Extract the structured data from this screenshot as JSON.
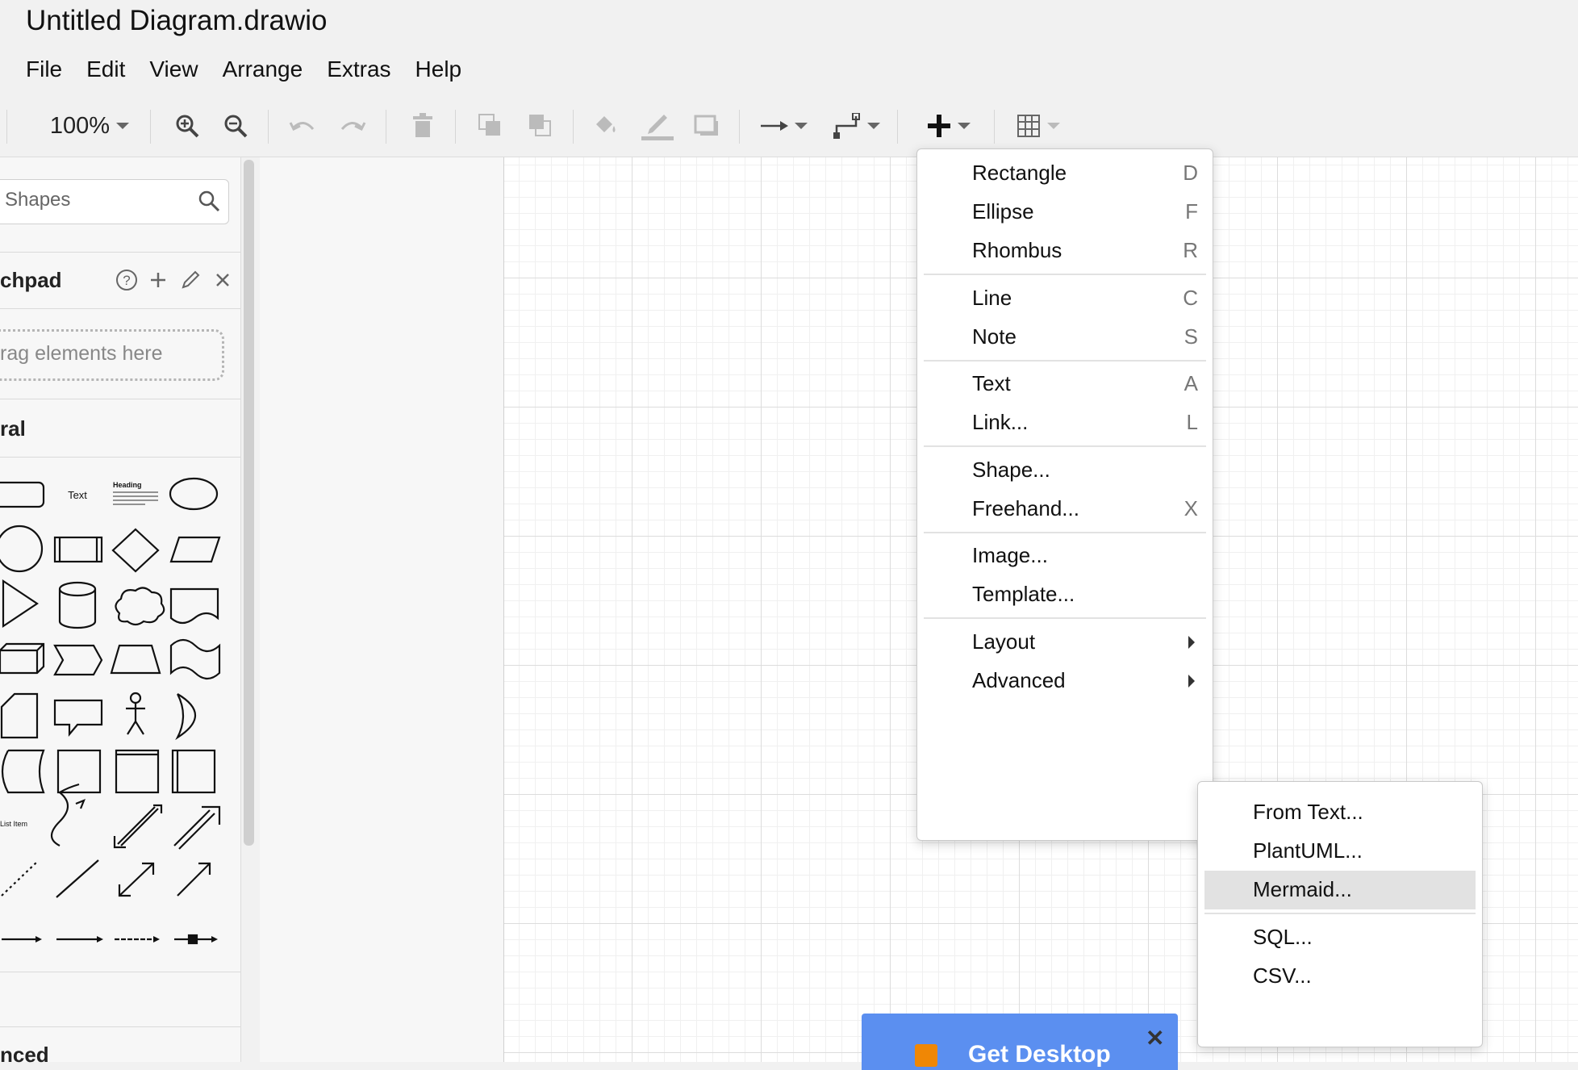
{
  "app": {
    "title": "Untitled Diagram.drawio"
  },
  "menubar": [
    "File",
    "Edit",
    "View",
    "Arrange",
    "Extras",
    "Help"
  ],
  "toolbar": {
    "zoom": "100%",
    "icons": [
      "zoom-in-icon",
      "zoom-out-icon",
      "undo-icon",
      "redo-icon",
      "delete-icon",
      "to-front-icon",
      "to-back-icon",
      "fill-color-icon",
      "line-color-icon",
      "shadow-icon",
      "connection-icon",
      "waypoints-icon",
      "insert-plus-icon",
      "table-icon"
    ]
  },
  "sidebar": {
    "search_placeholder": "Shapes",
    "scratchpad_title": "chpad",
    "drop_text": "rag elements here",
    "general_title": "ral",
    "advanced_title": "nced",
    "shape_labels": {
      "text": "Text",
      "heading": "Heading",
      "list_item": "List Item"
    }
  },
  "insert_menu": {
    "groups": [
      [
        {
          "label": "Rectangle",
          "key": "D"
        },
        {
          "label": "Ellipse",
          "key": "F"
        },
        {
          "label": "Rhombus",
          "key": "R"
        }
      ],
      [
        {
          "label": "Line",
          "key": "C"
        },
        {
          "label": "Note",
          "key": "S"
        }
      ],
      [
        {
          "label": "Text",
          "key": "A"
        },
        {
          "label": "Link...",
          "key": "L"
        }
      ],
      [
        {
          "label": "Shape...",
          "key": ""
        },
        {
          "label": "Freehand...",
          "key": "X"
        }
      ],
      [
        {
          "label": "Image...",
          "key": ""
        },
        {
          "label": "Template...",
          "key": ""
        }
      ],
      [
        {
          "label": "Layout",
          "key": "",
          "submenu": true
        },
        {
          "label": "Advanced",
          "key": "",
          "submenu": true
        }
      ]
    ]
  },
  "advanced_menu": {
    "groups": [
      [
        {
          "label": "From Text..."
        },
        {
          "label": "PlantUML..."
        },
        {
          "label": "Mermaid...",
          "highlighted": true
        }
      ],
      [
        {
          "label": "SQL..."
        },
        {
          "label": "CSV..."
        }
      ]
    ]
  },
  "banner": {
    "text": "Get Desktop",
    "close": "✕"
  },
  "colors": {
    "banner": "#5b8ff0",
    "highlight": "#e2e2e2",
    "grid": "#dcdcdc"
  }
}
